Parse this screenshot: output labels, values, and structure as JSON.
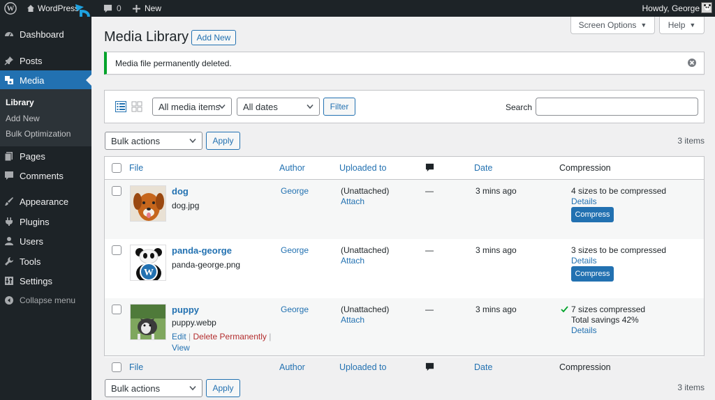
{
  "adminbar": {
    "site_name": "WordPress",
    "comments_count": "0",
    "new_label": "New",
    "howdy": "Howdy, George"
  },
  "sidebar": {
    "dashboard": "Dashboard",
    "posts": "Posts",
    "media": "Media",
    "library": "Library",
    "add_new": "Add New",
    "bulk_optimization": "Bulk Optimization",
    "pages": "Pages",
    "comments": "Comments",
    "appearance": "Appearance",
    "plugins": "Plugins",
    "users": "Users",
    "tools": "Tools",
    "settings": "Settings",
    "collapse": "Collapse menu"
  },
  "screen_options": "Screen Options",
  "help": "Help",
  "page_title": "Media Library",
  "add_new_button": "Add New",
  "notice": "Media file permanently deleted.",
  "filters": {
    "type": "All media items",
    "dates": "All dates",
    "filter_button": "Filter",
    "search_label": "Search",
    "search_value": ""
  },
  "bulk": {
    "label": "Bulk actions",
    "apply": "Apply",
    "items": "3 items"
  },
  "columns": {
    "file": "File",
    "author": "Author",
    "uploaded_to": "Uploaded to",
    "date": "Date",
    "compression": "Compression"
  },
  "rows": [
    {
      "title": "dog",
      "filename": "dog.jpg",
      "author": "George",
      "uploaded": "(Unattached)",
      "attach": "Attach",
      "comments": "—",
      "date": "3 mins ago",
      "compression_status": "4 sizes to be compressed",
      "details": "Details",
      "compress": "Compress"
    },
    {
      "title": "panda-george",
      "filename": "panda-george.png",
      "author": "George",
      "uploaded": "(Unattached)",
      "attach": "Attach",
      "comments": "—",
      "date": "3 mins ago",
      "compression_status": "3 sizes to be compressed",
      "details": "Details",
      "compress": "Compress"
    },
    {
      "title": "puppy",
      "filename": "puppy.webp",
      "author": "George",
      "uploaded": "(Unattached)",
      "attach": "Attach",
      "comments": "—",
      "date": "3 mins ago",
      "compression_status": "7 sizes compressed",
      "savings": "Total savings 42%",
      "details": "Details",
      "edit": "Edit",
      "delete": "Delete Permanently",
      "view": "View"
    }
  ],
  "colors": {
    "accent": "#2271b1",
    "sidebar_bg": "#1d2327",
    "success": "#00a32a",
    "danger": "#b32d2e"
  }
}
